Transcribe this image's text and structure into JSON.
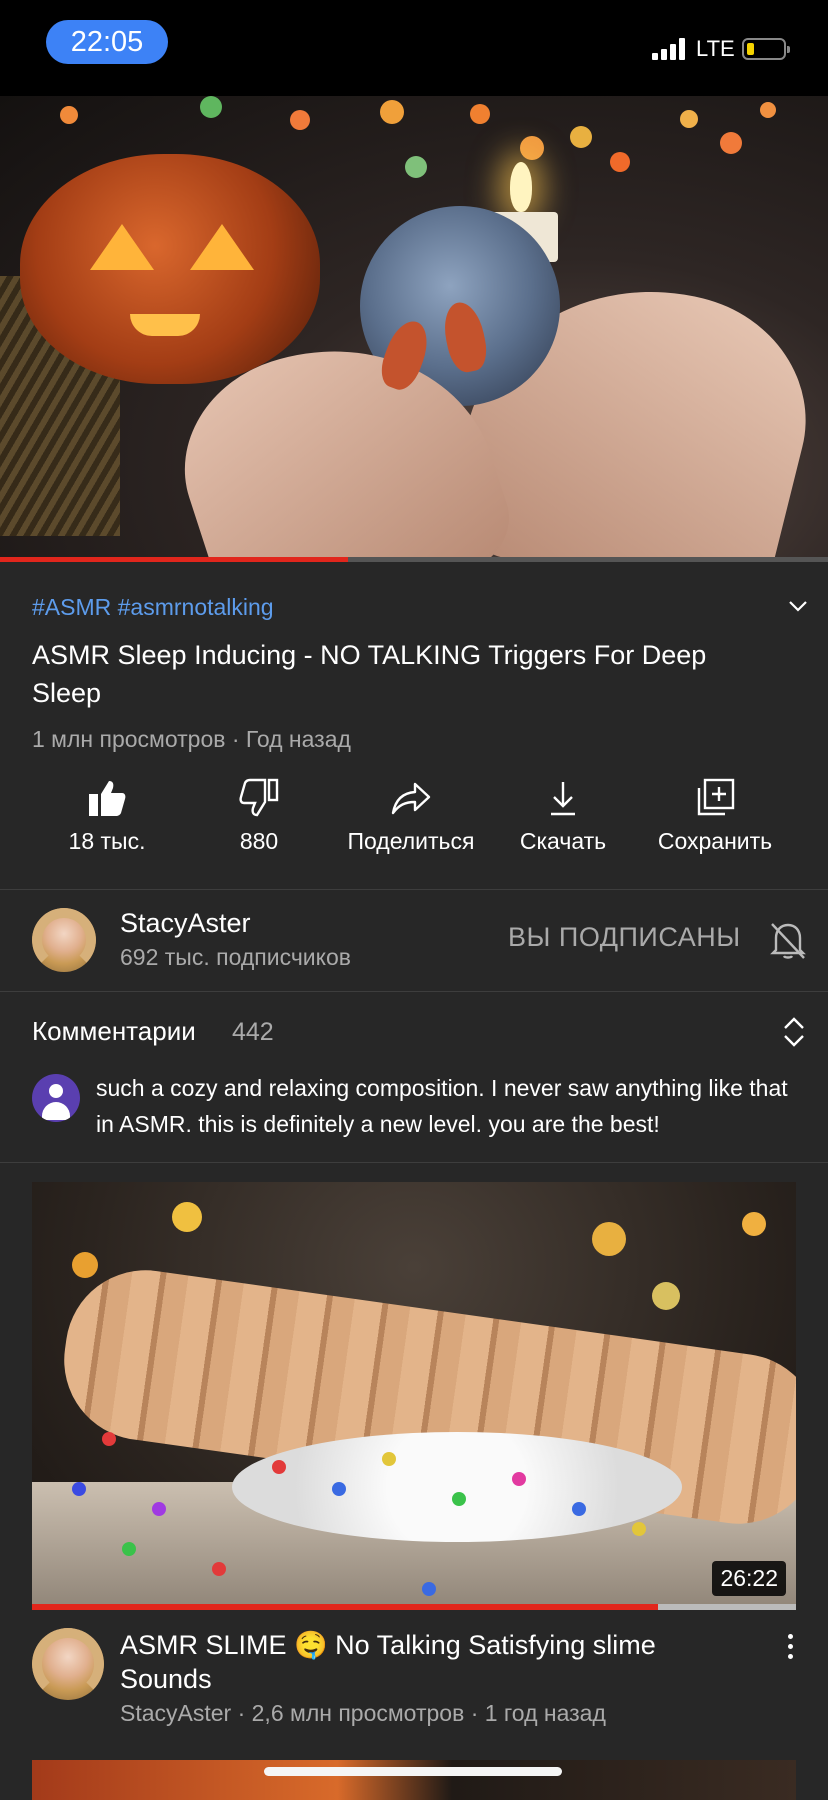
{
  "status_bar": {
    "time": "22:05",
    "network": "LTE",
    "signal_bars": 4,
    "battery_level": 0.2
  },
  "player": {
    "progress_fraction": 0.42,
    "played_color": "#e1261c"
  },
  "video": {
    "hashtags": "#ASMR #asmrnotalking",
    "title": "ASMR Sleep Inducing - NO TALKING Triggers For Deep Sleep",
    "meta": "1 млн просмотров · Год назад"
  },
  "actions": {
    "like": "18 тыс.",
    "dislike": "880",
    "share": "Поделиться",
    "download": "Скачать",
    "save": "Сохранить"
  },
  "channel": {
    "name": "StacyAster",
    "subscribers": "692 тыс. подписчиков",
    "subscribed_label": "ВЫ ПОДПИСАНЫ"
  },
  "comments": {
    "label": "Комментарии",
    "count": "442",
    "top_comment": "such a cozy and relaxing composition. I never saw anything like that in ASMR. this is definitely a new level. you are the best!"
  },
  "next_video": {
    "duration": "26:22",
    "watched_fraction": 0.82,
    "title": "ASMR SLIME 🤤 No Talking Satisfying slime Sounds",
    "meta": "StacyAster · 2,6 млн просмотров · 1 год назад"
  },
  "colors": {
    "accent_link": "#5d9cec",
    "background": "#272727",
    "time_pill": "#3d82f6"
  },
  "icons": {
    "like": "thumbs-up-icon",
    "dislike": "thumbs-down-icon",
    "share": "share-arrow-icon",
    "download": "download-icon",
    "save": "add-to-playlist-icon",
    "bell": "bell-off-icon",
    "sort": "sort-icon",
    "more": "more-vert-icon"
  }
}
